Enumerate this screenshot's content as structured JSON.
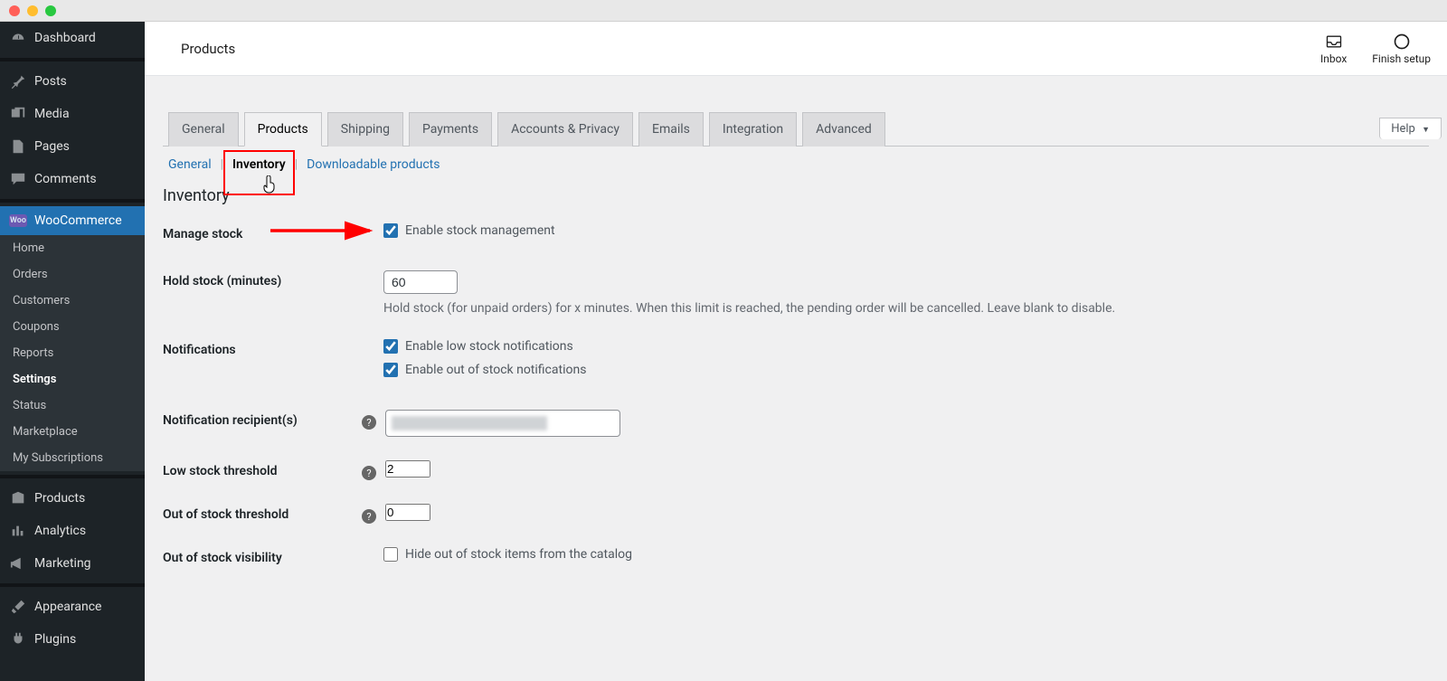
{
  "header": {
    "page_title": "Products",
    "inbox_label": "Inbox",
    "finish_label": "Finish setup",
    "help_label": "Help"
  },
  "sidebar": {
    "items": [
      {
        "label": "Dashboard",
        "icon": "dashboard"
      },
      {
        "label": "Posts",
        "icon": "pin"
      },
      {
        "label": "Media",
        "icon": "media"
      },
      {
        "label": "Pages",
        "icon": "page"
      },
      {
        "label": "Comments",
        "icon": "comment"
      },
      {
        "label": "WooCommerce",
        "icon": "woo",
        "current": true
      },
      {
        "label": "Products",
        "icon": "box"
      },
      {
        "label": "Analytics",
        "icon": "bars"
      },
      {
        "label": "Marketing",
        "icon": "megaphone"
      },
      {
        "label": "Appearance",
        "icon": "brush"
      },
      {
        "label": "Plugins",
        "icon": "plug"
      }
    ],
    "wc_sub": [
      {
        "label": "Home"
      },
      {
        "label": "Orders"
      },
      {
        "label": "Customers"
      },
      {
        "label": "Coupons"
      },
      {
        "label": "Reports"
      },
      {
        "label": "Settings",
        "current": true
      },
      {
        "label": "Status"
      },
      {
        "label": "Marketplace"
      },
      {
        "label": "My Subscriptions"
      }
    ]
  },
  "tabs": [
    {
      "label": "General"
    },
    {
      "label": "Products",
      "active": true
    },
    {
      "label": "Shipping"
    },
    {
      "label": "Payments"
    },
    {
      "label": "Accounts & Privacy"
    },
    {
      "label": "Emails"
    },
    {
      "label": "Integration"
    },
    {
      "label": "Advanced"
    }
  ],
  "subtabs": [
    {
      "label": "General"
    },
    {
      "label": "Inventory",
      "current": true
    },
    {
      "label": "Downloadable products"
    }
  ],
  "section_title": "Inventory",
  "fields": {
    "manage_stock": {
      "label": "Manage stock",
      "cb_label": "Enable stock management",
      "checked": true
    },
    "hold_stock": {
      "label": "Hold stock (minutes)",
      "value": "60",
      "desc": "Hold stock (for unpaid orders) for x minutes. When this limit is reached, the pending order will be cancelled. Leave blank to disable."
    },
    "notifications": {
      "label": "Notifications",
      "low_label": "Enable low stock notifications",
      "low_checked": true,
      "oos_label": "Enable out of stock notifications",
      "oos_checked": true
    },
    "recipients": {
      "label": "Notification recipient(s)"
    },
    "low_threshold": {
      "label": "Low stock threshold",
      "value": "2"
    },
    "oos_threshold": {
      "label": "Out of stock threshold",
      "value": "0"
    },
    "oos_visibility": {
      "label": "Out of stock visibility",
      "cb_label": "Hide out of stock items from the catalog",
      "checked": false
    }
  },
  "annotations": {
    "arrow_target": "manage-stock-checkbox",
    "red_box_target": "subtab-inventory"
  }
}
